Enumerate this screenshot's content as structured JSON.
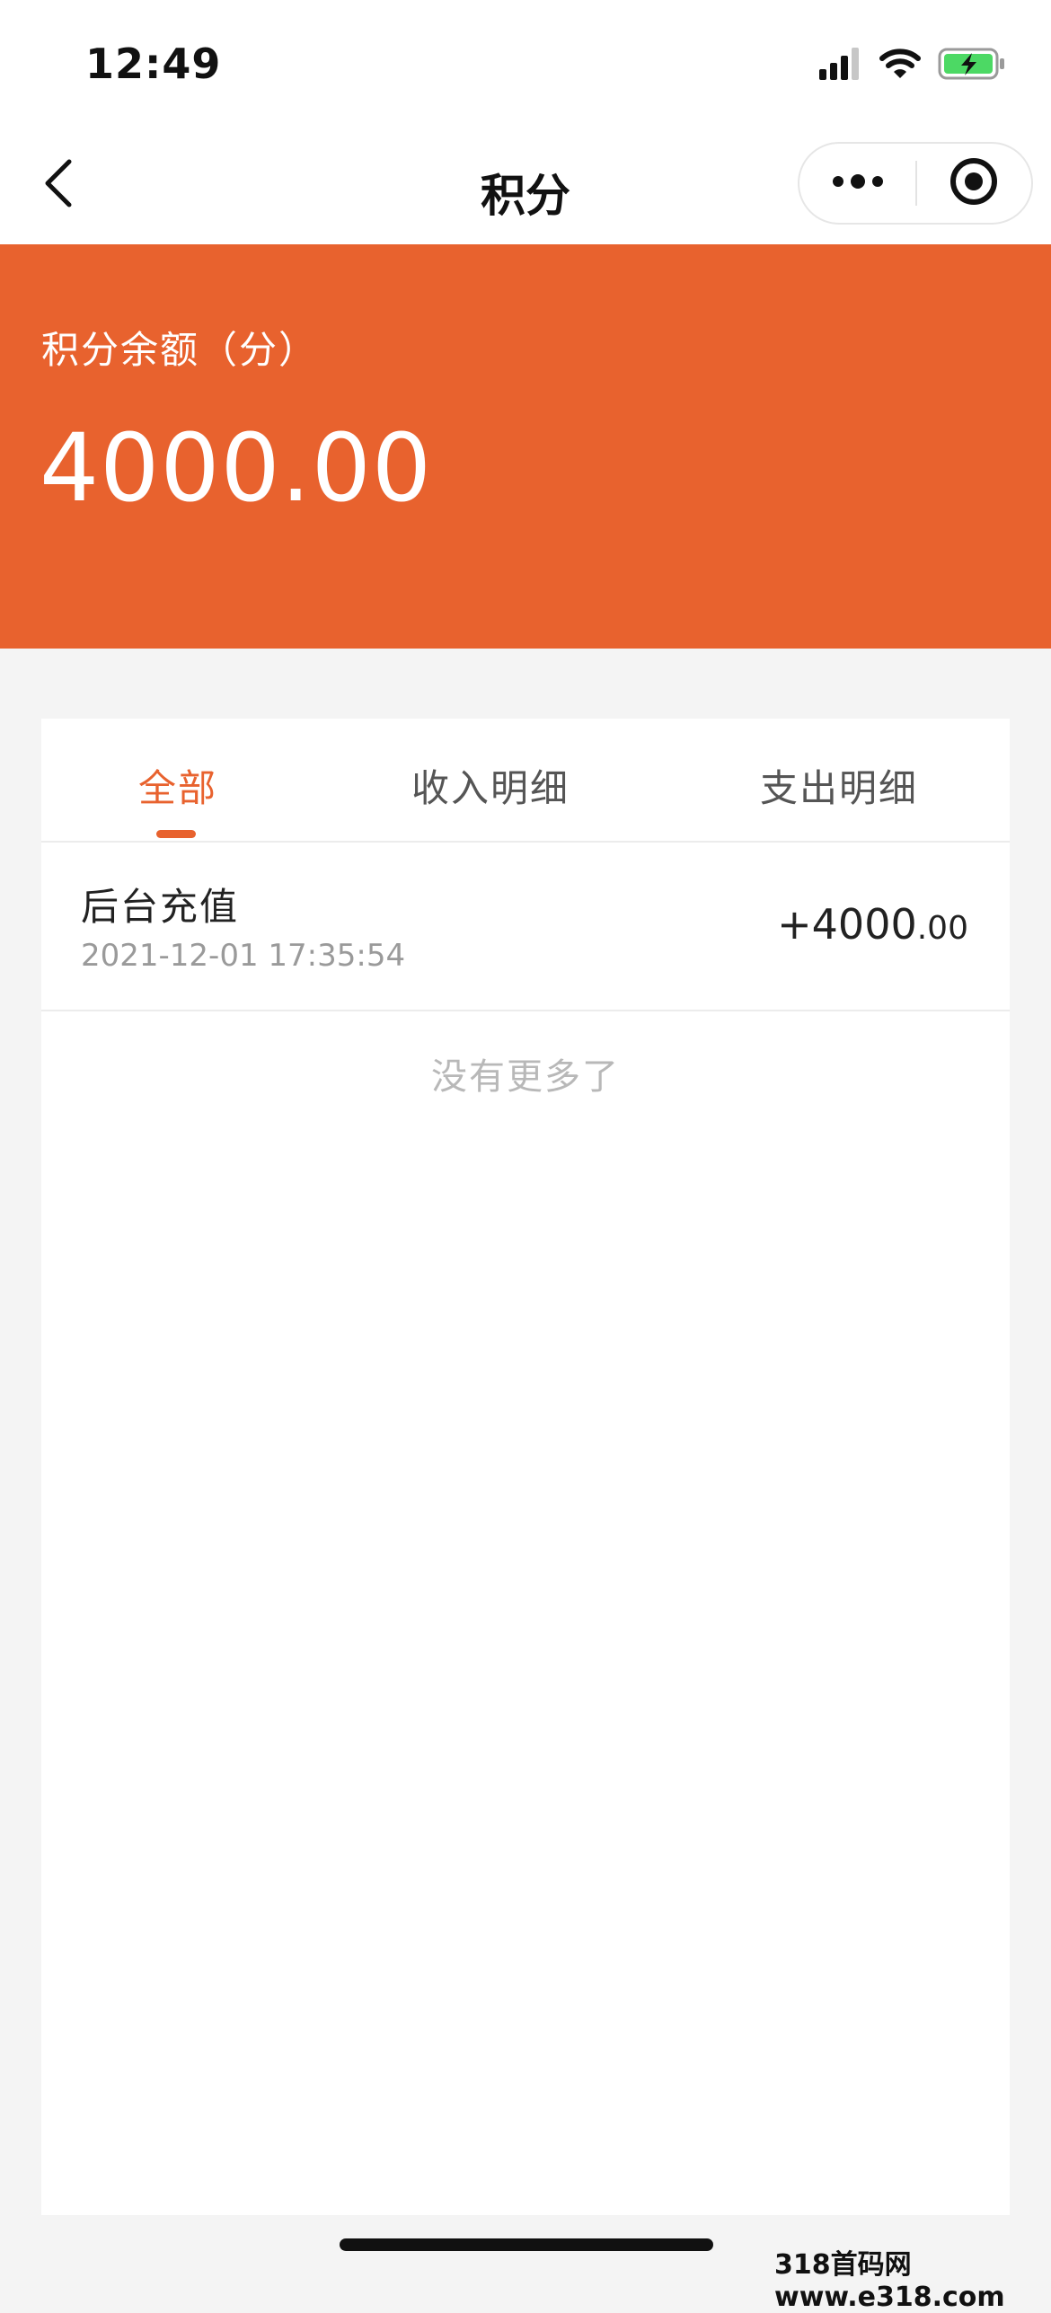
{
  "status_bar": {
    "time": "12:49",
    "icons": [
      "cellular-signal-icon",
      "wifi-icon",
      "battery-charging-icon"
    ]
  },
  "nav": {
    "title": "积分",
    "icons": [
      "back-chevron-icon",
      "more-dots-icon",
      "close-target-icon"
    ]
  },
  "balance": {
    "label": "积分余额（分）",
    "amount": "4000.00"
  },
  "tabs": [
    {
      "label": "全部",
      "active": true
    },
    {
      "label": "收入明细",
      "active": false
    },
    {
      "label": "支出明细",
      "active": false
    }
  ],
  "records": [
    {
      "title": "后台充值",
      "time": "2021-12-01 17:35:54",
      "amount_integer": "+4000",
      "amount_decimal": ".00"
    }
  ],
  "no_more_text": "没有更多了",
  "watermark": "318首码网 www.e318.com",
  "colors": {
    "accent": "#e8622e",
    "background": "#f4f4f4",
    "card": "#ffffff",
    "muted_text": "#9a9a9a"
  }
}
